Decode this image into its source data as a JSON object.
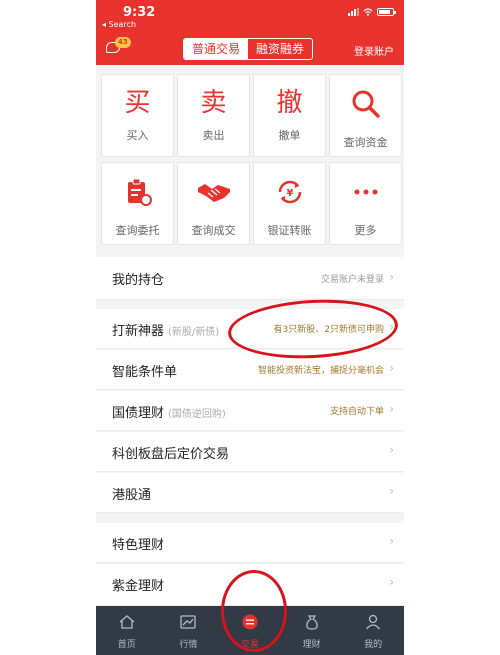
{
  "status": {
    "time": "9:32",
    "back": "◂ Search"
  },
  "header": {
    "badge": "43",
    "tabs": [
      "普通交易",
      "融资融券"
    ],
    "login": "登录账户"
  },
  "grid": [
    {
      "char": "买",
      "label": "买入"
    },
    {
      "char": "卖",
      "label": "卖出"
    },
    {
      "char": "撤",
      "label": "撤单"
    },
    {
      "icon": "search-icon",
      "label": "查询资金"
    },
    {
      "icon": "clipboard-icon",
      "label": "查询委托"
    },
    {
      "icon": "handshake-icon",
      "label": "查询成交"
    },
    {
      "icon": "yen-transfer-icon",
      "label": "银证转账"
    },
    {
      "icon": "more-dots-icon",
      "label": "更多"
    }
  ],
  "rows": [
    {
      "title": "我的持仓",
      "sub": "",
      "right": "交易账户未登录",
      "right_style": "grey"
    },
    {
      "title": "打新神器",
      "sub": "(新股/新债)",
      "right": "有3只新股、2只新债可申购",
      "right_style": "gold"
    },
    {
      "title": "智能条件单",
      "sub": "",
      "right": "智能投资新法宝，捕捉分毫机会",
      "right_style": "gold"
    },
    {
      "title": "国债理财",
      "sub": "(国债逆回购)",
      "right": "支持自动下单",
      "right_style": "gold"
    },
    {
      "title": "科创板盘后定价交易",
      "sub": "",
      "right": "",
      "right_style": "grey"
    },
    {
      "title": "港股通",
      "sub": "",
      "right": "",
      "right_style": "grey"
    },
    {
      "title": "特色理财",
      "sub": "",
      "right": "",
      "right_style": "grey"
    },
    {
      "title": "紫金理财",
      "sub": "",
      "right": "",
      "right_style": "grey"
    }
  ],
  "chevron": "›",
  "tabs": [
    {
      "label": "首页",
      "icon": "home-icon"
    },
    {
      "label": "行情",
      "icon": "chart-icon"
    },
    {
      "label": "交易",
      "icon": "trade-icon"
    },
    {
      "label": "理财",
      "icon": "moneybag-icon"
    },
    {
      "label": "我的",
      "icon": "person-icon"
    }
  ],
  "colors": {
    "brand": "#e8322d",
    "tabbar": "#323a45",
    "gold": "#a07a2a"
  }
}
